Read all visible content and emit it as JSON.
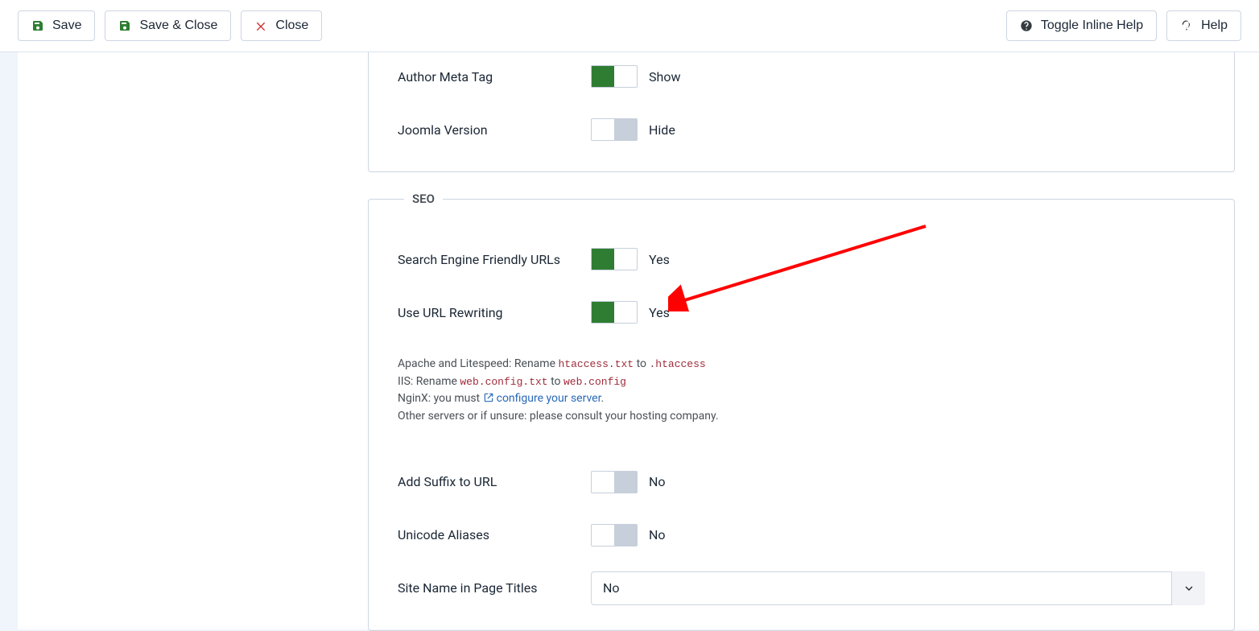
{
  "toolbar": {
    "save": "Save",
    "save_close": "Save & Close",
    "close": "Close",
    "toggle_help": "Toggle Inline Help",
    "help": "Help"
  },
  "top_group": {
    "author_meta": {
      "label": "Author Meta Tag",
      "value": "Show",
      "on": true
    },
    "joomla_version": {
      "label": "Joomla Version",
      "value": "Hide",
      "on": false
    }
  },
  "seo": {
    "legend": "SEO",
    "sef": {
      "label": "Search Engine Friendly URLs",
      "value": "Yes",
      "on": true
    },
    "rewrite": {
      "label": "Use URL Rewriting",
      "value": "Yes",
      "on": true
    },
    "help": {
      "apache_prefix": "Apache and Litespeed: Rename ",
      "apache_code1": "htaccess.txt",
      "apache_mid": " to ",
      "apache_code2": ".htaccess",
      "iis_prefix": "IIS: Rename ",
      "iis_code1": "web.config.txt",
      "iis_mid": " to ",
      "iis_code2": "web.config",
      "nginx_prefix": "NginX: you must ",
      "nginx_link": "configure your server",
      "nginx_suffix": ".",
      "other": "Other servers or if unsure: please consult your hosting company."
    },
    "suffix": {
      "label": "Add Suffix to URL",
      "value": "No",
      "on": false
    },
    "unicode": {
      "label": "Unicode Aliases",
      "value": "No",
      "on": false
    },
    "sitename": {
      "label": "Site Name in Page Titles",
      "value": "No"
    }
  }
}
